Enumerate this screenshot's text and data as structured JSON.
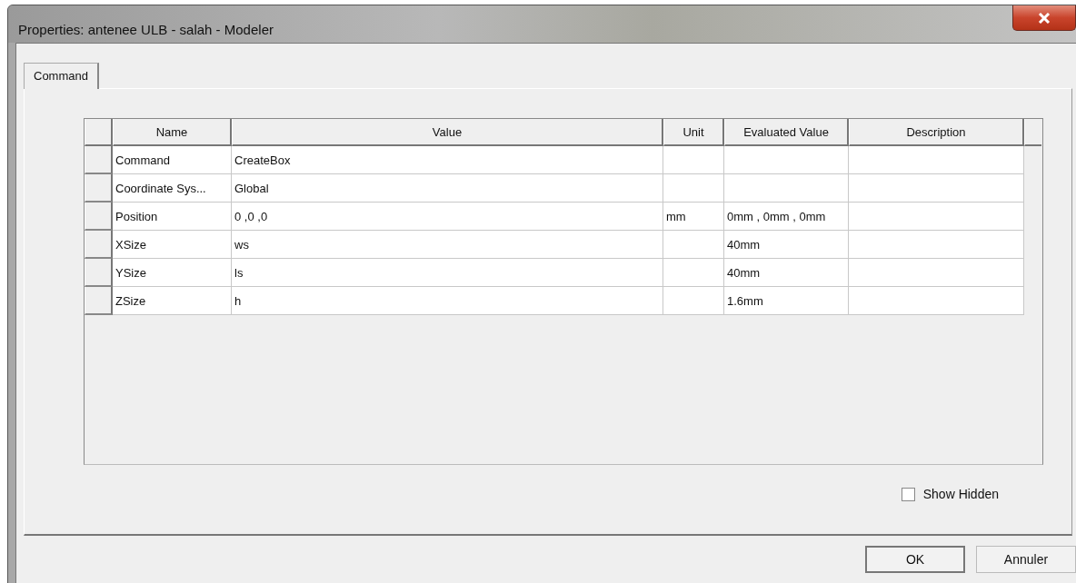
{
  "window": {
    "title": "Properties: antenee ULB - salah - Modeler"
  },
  "tabs": [
    {
      "label": "Command",
      "selected": true
    }
  ],
  "table": {
    "columns": [
      "Name",
      "Value",
      "Unit",
      "Evaluated Value",
      "Description"
    ],
    "rows": [
      {
        "name": "Command",
        "value": "CreateBox",
        "unit": "",
        "evaluated": "",
        "description": ""
      },
      {
        "name": "Coordinate Sys...",
        "value": "Global",
        "unit": "",
        "evaluated": "",
        "description": ""
      },
      {
        "name": "Position",
        "value": "0 ,0 ,0",
        "unit": "mm",
        "evaluated": "0mm , 0mm , 0mm",
        "description": ""
      },
      {
        "name": "XSize",
        "value": "ws",
        "unit": "",
        "evaluated": "40mm",
        "description": ""
      },
      {
        "name": "YSize",
        "value": "ls",
        "unit": "",
        "evaluated": "40mm",
        "description": ""
      },
      {
        "name": "ZSize",
        "value": "h",
        "unit": "",
        "evaluated": "1.6mm",
        "description": ""
      }
    ]
  },
  "show_hidden": {
    "label": "Show Hidden",
    "checked": false
  },
  "buttons": [
    {
      "label": "OK",
      "default": true
    },
    {
      "label": "Annuler",
      "default": false
    }
  ]
}
